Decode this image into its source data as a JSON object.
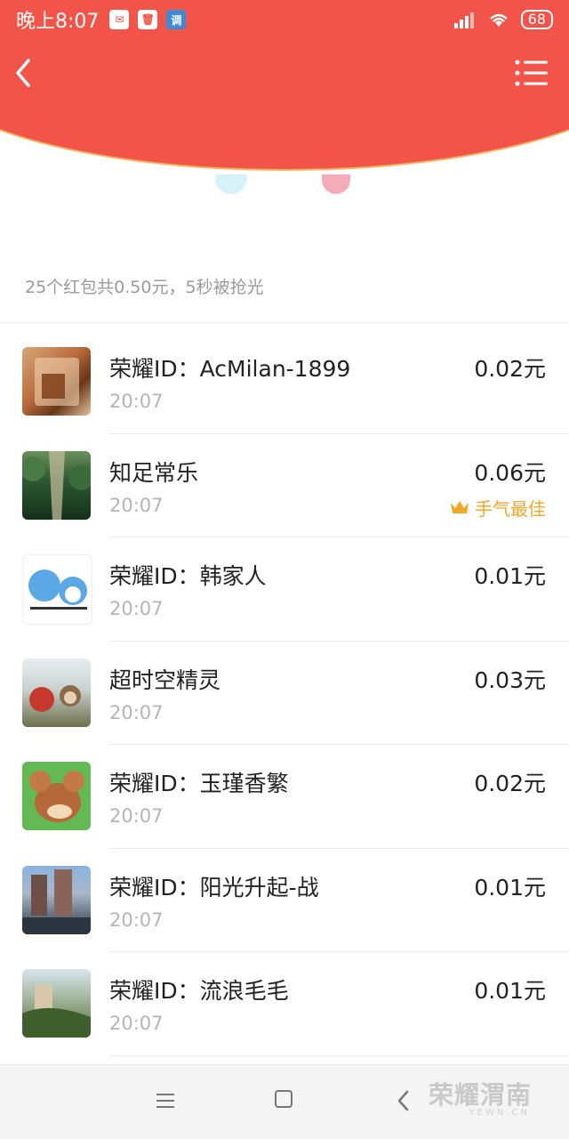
{
  "status": {
    "time": "晚上8:07",
    "battery": "68"
  },
  "summary": "25个红包共0.50元，5秒被抢光",
  "records": [
    {
      "name": "荣耀ID：AcMilan-1899",
      "time": "20:07",
      "amount": "0.02元"
    },
    {
      "name": "知足常乐",
      "time": "20:07",
      "amount": "0.06元",
      "best": "手气最佳"
    },
    {
      "name": "荣耀ID：韩家人",
      "time": "20:07",
      "amount": "0.01元"
    },
    {
      "name": "超时空精灵",
      "time": "20:07",
      "amount": "0.03元"
    },
    {
      "name": "荣耀ID：玉瑾香繁",
      "time": "20:07",
      "amount": "0.02元"
    },
    {
      "name": "荣耀ID：阳光升起-战",
      "time": "20:07",
      "amount": "0.01元"
    },
    {
      "name": "荣耀ID：流浪毛毛",
      "time": "20:07",
      "amount": "0.01元"
    }
  ],
  "watermark": {
    "brand": "荣耀渭南",
    "domain": "YEWN.CN"
  },
  "colors": {
    "header_red": "#f2544a",
    "best_gold": "#f2a728"
  },
  "icons": {
    "back": "chevron-left",
    "menu": "list-menu",
    "crown": "crown"
  }
}
